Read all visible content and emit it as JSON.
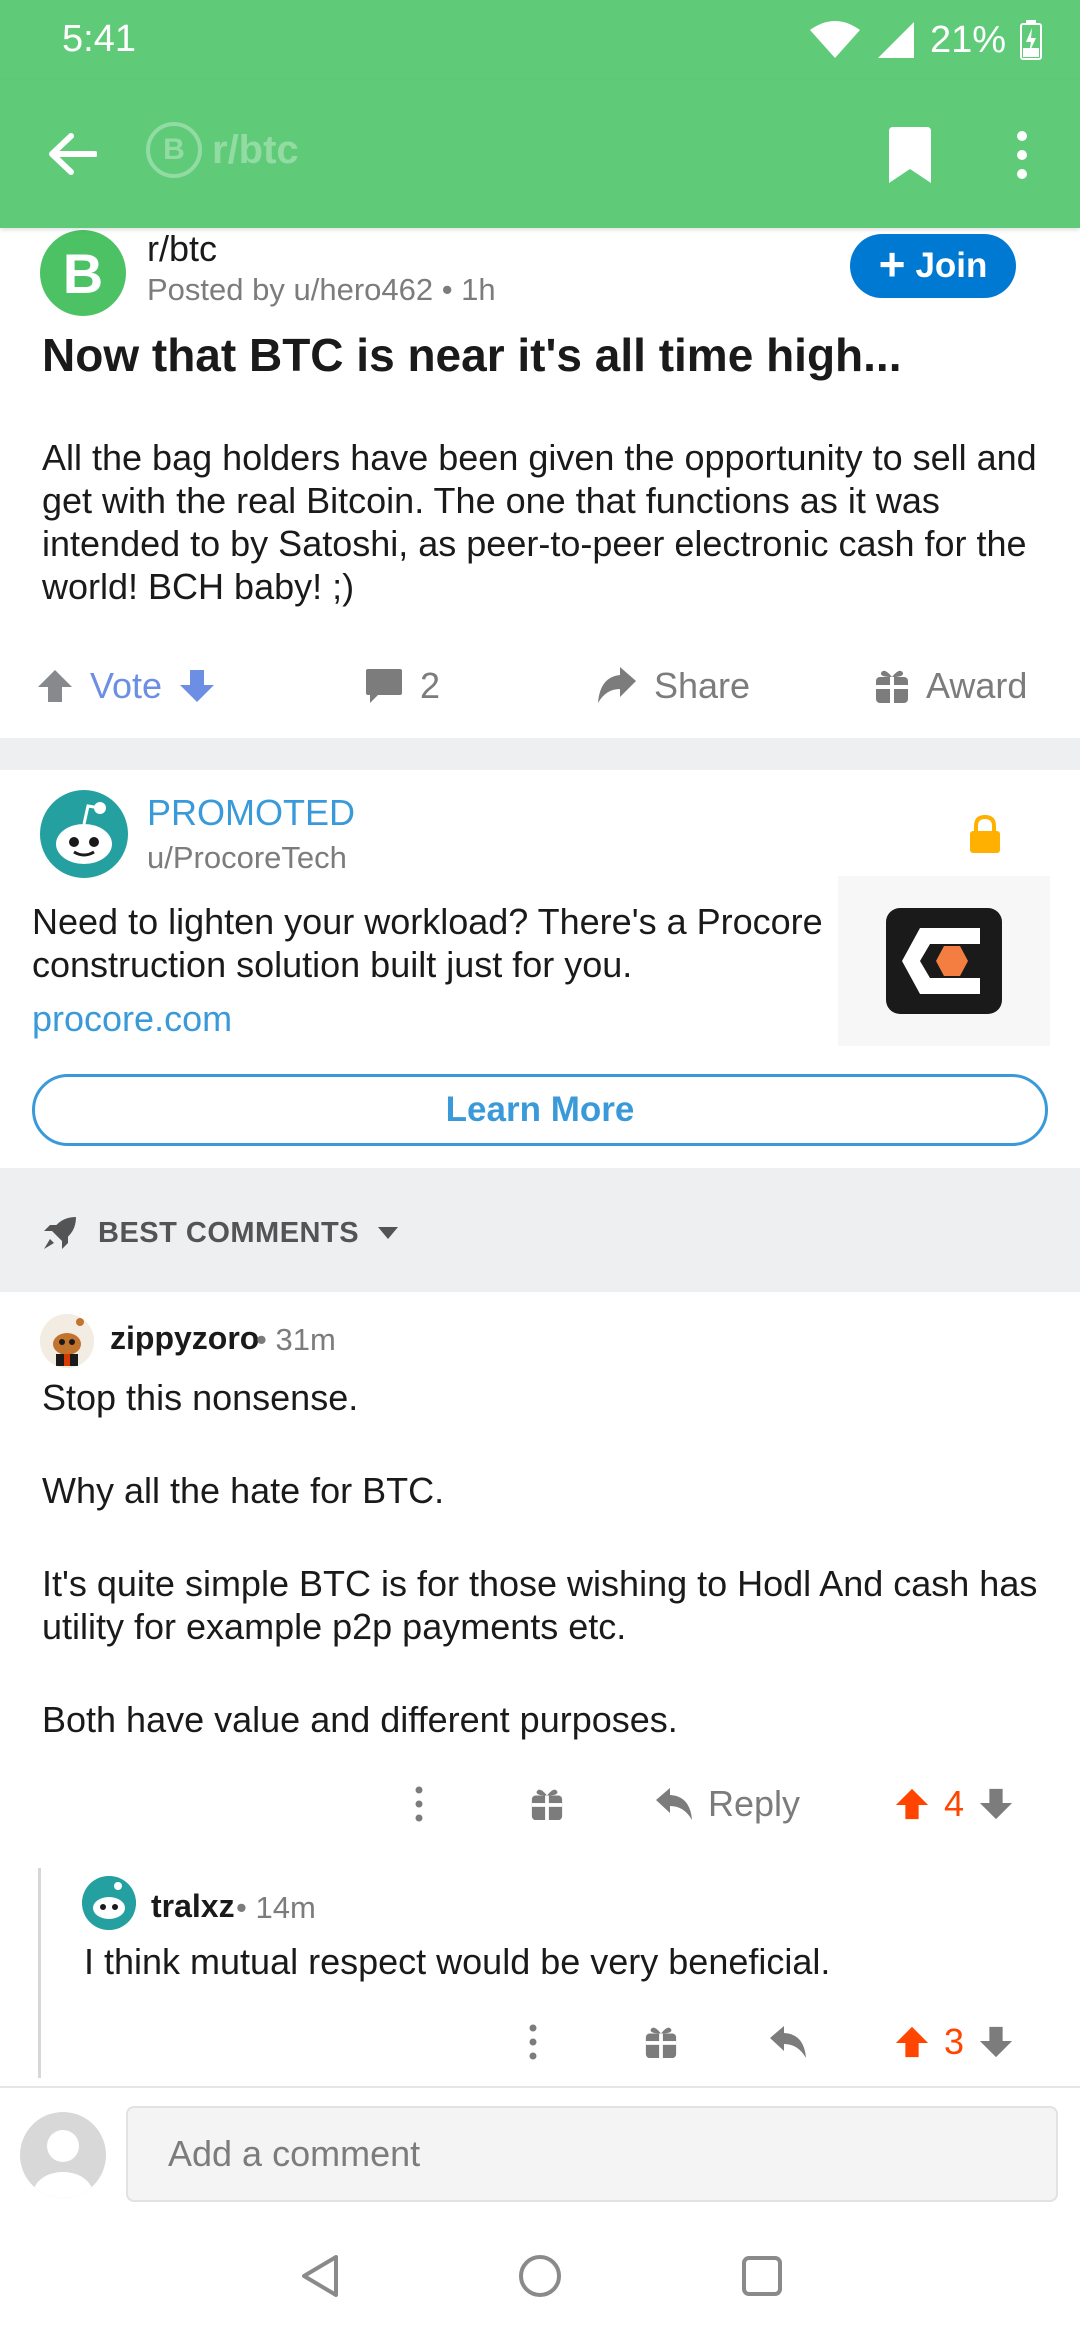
{
  "status_bar": {
    "time": "5:41",
    "battery": "21%"
  },
  "app_bar": {
    "ghost_title": "r/btc",
    "ghost_icon_letter": "B"
  },
  "post": {
    "subreddit": "r/btc",
    "subreddit_icon_letter": "B",
    "posted_by": "Posted by u/hero462 • 1h",
    "join_label": "Join",
    "title": "Now that BTC is near it's all time high...",
    "body": "All the bag holders have been given the opportunity to sell and get with the real Bitcoin.  The one that functions as it was intended to by Satoshi, as peer-to-peer electronic cash for the world!  BCH baby! ;)",
    "actions": {
      "vote_label": "Vote",
      "comment_count": "2",
      "share_label": "Share",
      "award_label": "Award"
    }
  },
  "promo": {
    "label": "PROMOTED",
    "user": "u/ProcoreTech",
    "text": "Need to lighten your workload? There's a Procore construction solution built just for you.",
    "link": "procore.com",
    "cta": "Learn More",
    "accent_color": "#3a9ad9"
  },
  "sort": {
    "label": "BEST COMMENTS"
  },
  "comments": [
    {
      "author": "zippyzoro",
      "time": "• 31m",
      "paragraphs": [
        "Stop this nonsense.",
        "Why all the hate for BTC.",
        "It's quite simple BTC is for those wishing to Hodl And cash has utility for example p2p payments etc.",
        "Both have value and different purposes."
      ],
      "reply_label": "Reply",
      "score": "4"
    },
    {
      "author": "tralxz",
      "time": "• 14m",
      "body": "I think mutual respect would be very beneficial.",
      "score": "3"
    }
  ],
  "comment_bar": {
    "placeholder": "Add a comment"
  },
  "colors": {
    "header_green": "#5fcb78",
    "join_blue": "#0079d3",
    "upvote_orange": "#ff4500",
    "vote_blue": "#6c8fe3"
  }
}
